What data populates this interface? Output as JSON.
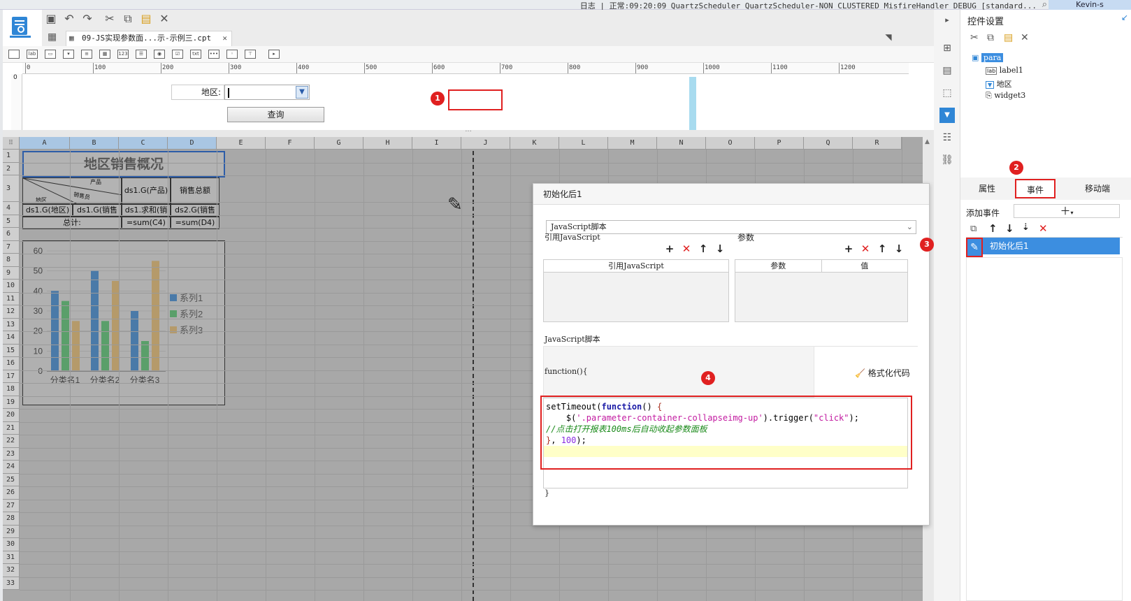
{
  "topbar": {
    "status": "日志 | 正常:09:20:09 QuartzScheduler_QuartzScheduler-NON_CLUSTERED_MisfireHandler DEBUG [standard...",
    "user": "Kevin-s"
  },
  "file_tab": {
    "title": "09-JS实现参数面...示-示例三.cpt",
    "close": "✕"
  },
  "ruler_labels": [
    "0",
    "100",
    "200",
    "300",
    "400",
    "500",
    "600",
    "700",
    "800",
    "900",
    "1000",
    "1100",
    "1200"
  ],
  "param_panel": {
    "label": "地区:",
    "query_button": "查询"
  },
  "sheet": {
    "columns": [
      "A",
      "B",
      "C",
      "D",
      "E",
      "F",
      "G",
      "H",
      "I",
      "J",
      "K",
      "L",
      "M",
      "N",
      "O",
      "P",
      "Q",
      "R"
    ],
    "rows": [
      "1",
      "2",
      "3",
      "4",
      "5",
      "6",
      "7",
      "8",
      "9",
      "10",
      "11",
      "12",
      "13",
      "14",
      "15",
      "16",
      "17",
      "18",
      "19",
      "20",
      "21",
      "22",
      "23",
      "24",
      "25",
      "26",
      "27",
      "28",
      "29",
      "30",
      "31",
      "32",
      "33"
    ],
    "title": "地区销售概况",
    "diag_top": "产品",
    "diag_mid": "销售员",
    "diag_bottom": "地区",
    "c3": "ds1.G(产品)",
    "d3": "销售总额",
    "a4": "ds1.G(地区)",
    "b4": "ds1.G(销售",
    "c4": "ds1.求和(销",
    "d4": "ds2.G(销售",
    "a5": "总计:",
    "c5": "=sum(C4)",
    "d5": "=sum(D4)"
  },
  "chart_data": {
    "type": "bar",
    "categories": [
      "分类名1",
      "分类名2",
      "分类名3"
    ],
    "series": [
      {
        "name": "系列1",
        "values": [
          40,
          50,
          30
        ],
        "color": "#4a7aa8"
      },
      {
        "name": "系列2",
        "values": [
          35,
          25,
          15
        ],
        "color": "#5a9f6a"
      },
      {
        "name": "系列3",
        "values": [
          25,
          45,
          55
        ],
        "color": "#b59a6a"
      }
    ],
    "yticks": [
      "0",
      "10",
      "20",
      "30",
      "40",
      "50",
      "60"
    ],
    "ylim": [
      0,
      60
    ],
    "legend": "right"
  },
  "dialog": {
    "title": "初始化后1",
    "type_select": "JavaScript脚本",
    "ref_js_label": "引用JavaScript",
    "params_label": "参数",
    "ref_js_header": "引用JavaScript",
    "param_header": "参数",
    "value_header": "值",
    "script_label": "JavaScript脚本",
    "func_open": "function(){",
    "format_code": "格式化代码",
    "func_close": "}"
  },
  "right_panel": {
    "title": "控件设置",
    "tree": [
      "para",
      "label1",
      "地区",
      "widget3"
    ],
    "tabs": [
      "属性",
      "事件",
      "移动端"
    ],
    "add_event": "添加事件",
    "event_item": "初始化后1"
  },
  "annotations": [
    "1",
    "2",
    "3",
    "4"
  ],
  "colors": {
    "accent": "#e02020",
    "selection": "#3c8ee0",
    "chart_bg": "#b0b0b0"
  }
}
